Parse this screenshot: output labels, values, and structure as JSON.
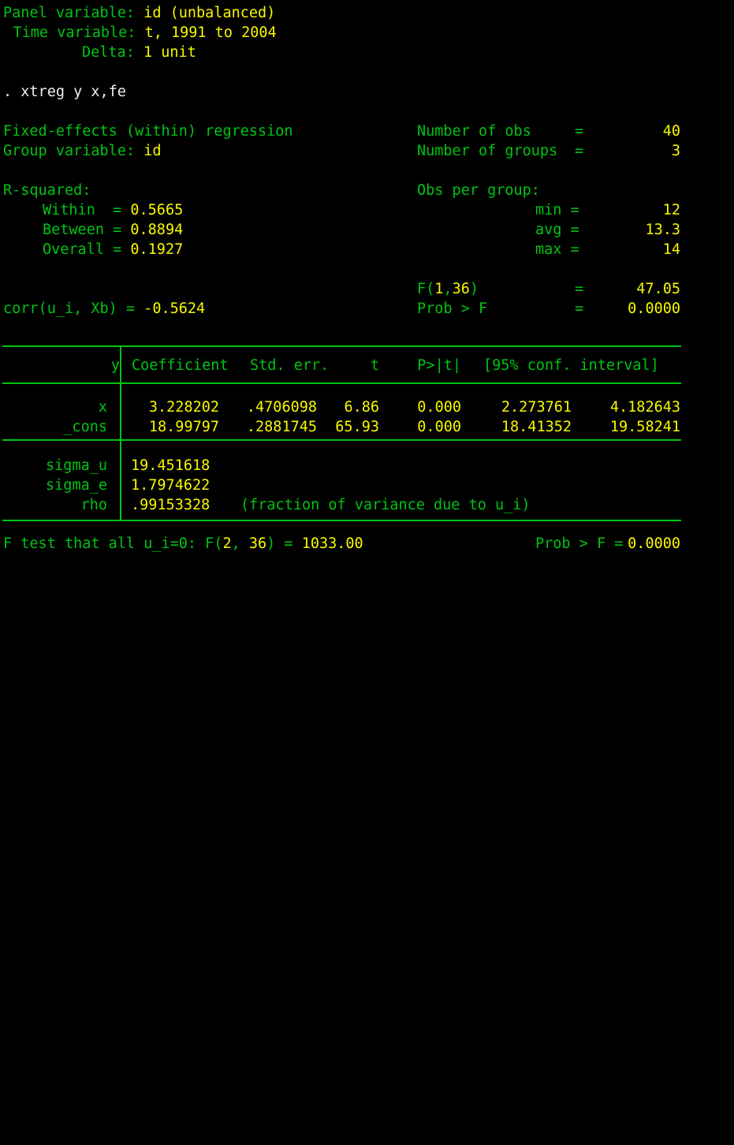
{
  "console": {
    "colors": {
      "background": "#000000",
      "label": "#00c413",
      "value": "#f8f800",
      "command": "#f0f0f0"
    }
  },
  "panel_header": {
    "panel_variable_label": "Panel variable:",
    "panel_variable_value": "id (unbalanced)",
    "time_variable_label": "Time variable:",
    "time_variable_value": "t, 1991 to 2004",
    "delta_label": "Delta:",
    "delta_value": "1 unit"
  },
  "command": {
    "prompt": ".",
    "text": "xtreg y x,fe",
    "full_line": ". xtreg y x,fe"
  },
  "model": {
    "title": "Fixed-effects (within) regression",
    "group_variable_label": "Group variable:",
    "group_variable_value": "id",
    "r_squared_header": "R-squared:",
    "r_squared": [
      {
        "label": "Within",
        "eq": "=",
        "value": "0.5665"
      },
      {
        "label": "Between",
        "eq": "=",
        "value": "0.8894"
      },
      {
        "label": "Overall",
        "eq": "=",
        "value": "0.1927"
      }
    ],
    "corr_label": "corr(u_i, Xb) =",
    "corr_value": "-0.5624"
  },
  "stats": {
    "n_obs_label": "Number of obs",
    "n_obs_eq": "=",
    "n_obs_value": "40",
    "n_groups_label": "Number of groups",
    "n_groups_eq": "=",
    "n_groups_value": "3",
    "obs_per_group_header": "Obs per group:",
    "obs_per_group": [
      {
        "label": "min =",
        "value": "12"
      },
      {
        "label": "avg =",
        "value": "13.3"
      },
      {
        "label": "max =",
        "value": "14"
      }
    ],
    "f_label_prefix": "F(",
    "f_df1": "1",
    "f_comma": ",",
    "f_df2": "36",
    "f_label_suffix": ")",
    "f_eq": "=",
    "f_value": "47.05",
    "prob_label": "Prob > F",
    "prob_eq": "=",
    "prob_value": "0.0000"
  },
  "coef_table": {
    "dep_var": "y",
    "headers": [
      "Coefficient",
      "Std. err.",
      "t",
      "P>|t|",
      "[95% conf. interval]"
    ],
    "rows": [
      {
        "name": "x",
        "coefficient": "3.228202",
        "std_err": ".4706098",
        "t": "6.86",
        "p_value": "0.000",
        "ci_low": "2.273761",
        "ci_high": "4.182643"
      },
      {
        "name": "_cons",
        "coefficient": "18.99797",
        "std_err": ".2881745",
        "t": "65.93",
        "p_value": "0.000",
        "ci_low": "18.41352",
        "ci_high": "19.58241"
      }
    ],
    "variance": [
      {
        "name": "sigma_u",
        "value": "19.451618",
        "note": ""
      },
      {
        "name": "sigma_e",
        "value": "1.7974622",
        "note": ""
      },
      {
        "name": "rho",
        "value": ".99153328",
        "note": "(fraction of variance due to u_i)"
      }
    ]
  },
  "ftest": {
    "text_prefix": "F test that all u_i=0: F(",
    "df1": "2",
    "comma_space": ", ",
    "df2": "36",
    "paren_eq": ") =",
    "f_value": "1033.00",
    "prob_label": "Prob > F =",
    "prob_value": "0.0000"
  }
}
